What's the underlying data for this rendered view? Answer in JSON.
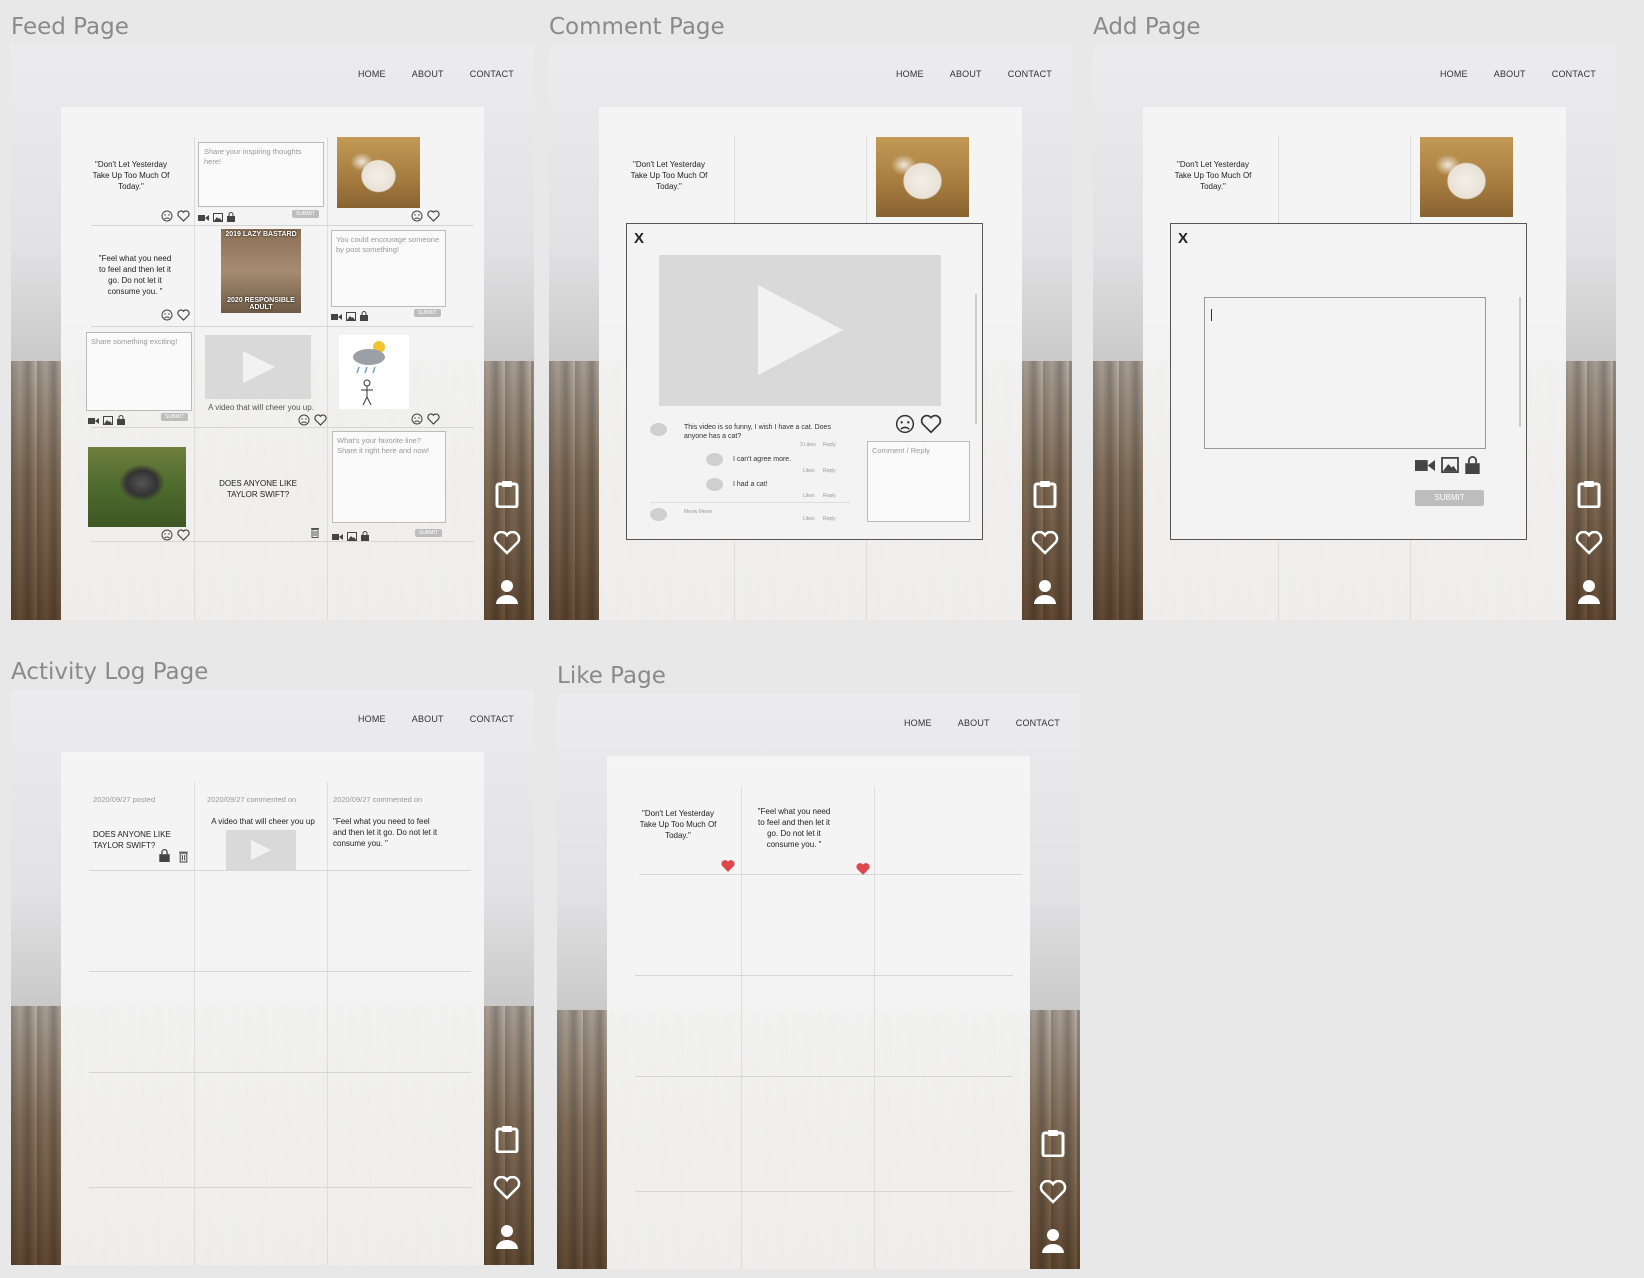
{
  "titles": {
    "feed": "Feed Page",
    "comment": "Comment Page",
    "add": "Add Page",
    "activity": "Activity Log Page",
    "like": "Like Page"
  },
  "nav": {
    "home": "HOME",
    "about": "ABOUT",
    "contact": "CONTACT"
  },
  "quotes": {
    "q1": "\"Don't Let Yesterday Take Up Too Much Of Today.\"",
    "q2": "\"Feel what you need to feel and then let it go. Do not let it consume you. \"",
    "q3": "DOES ANYONE LIKE TAYLOR SWIFT?"
  },
  "feed": {
    "ph_inspiring": "Share your inspiring thoughts here!",
    "ph_encourage": "You could encourage someone by post something!",
    "ph_exciting": "Share something exciting!",
    "ph_favorite": "What's your favorite line? Share it right here and now!",
    "video_caption": "A video that will cheer you up.",
    "submit": "SUBMIT",
    "meme_top": "2019 LAZY BASTARD",
    "meme_bottom": "2020 RESPONSIBLE ADULT"
  },
  "comment": {
    "close": "X",
    "comments": [
      {
        "text": "This video is so funny, I wish I have a cat. Does anyone has a cat?",
        "likes": "3 Likes",
        "reply": "Reply"
      },
      {
        "text": "I can't agree more.",
        "likes": "Likes",
        "reply": "Reply"
      },
      {
        "text": "I had a cat!",
        "likes": "Likes",
        "reply": "Reply"
      },
      {
        "text": "Meow Meow",
        "likes": "Likes",
        "reply": "Reply"
      }
    ],
    "reply_placeholder": "Comment / Reply"
  },
  "add": {
    "close": "X",
    "submit": "SUBMIT"
  },
  "activity": {
    "entries": [
      {
        "meta": "2020/09/27 posted",
        "text": "DOES ANYONE LIKE TAYLOR SWIFT?"
      },
      {
        "meta": "2020/09/27 commented on",
        "text": "A video that will cheer you up"
      },
      {
        "meta": "2020/09/27 commented on",
        "text": "\"Feel what you need to feel and then let it go. Do not let it consume you. \""
      }
    ]
  },
  "colors": {
    "background": "#e8e8e8",
    "heart_red": "#e0474c",
    "submit_grey": "#bdbdbd"
  }
}
